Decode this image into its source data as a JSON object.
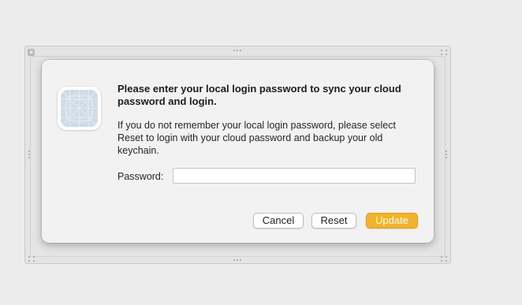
{
  "dialog": {
    "title": "Please enter your local login password to sync your cloud password and login.",
    "message": "If you do not remember your local login password, please select Reset to login with your cloud password and backup your old keychain.",
    "password_label": "Password:",
    "password_value": "",
    "app_icon": "app-placeholder-icon",
    "buttons": {
      "cancel": "Cancel",
      "reset": "Reset",
      "update": "Update"
    }
  },
  "frame": {
    "close_glyph": "×"
  },
  "colors": {
    "accent": "#f2b32a",
    "dialog_bg": "#f2f2f2",
    "backdrop": "#ececec"
  }
}
